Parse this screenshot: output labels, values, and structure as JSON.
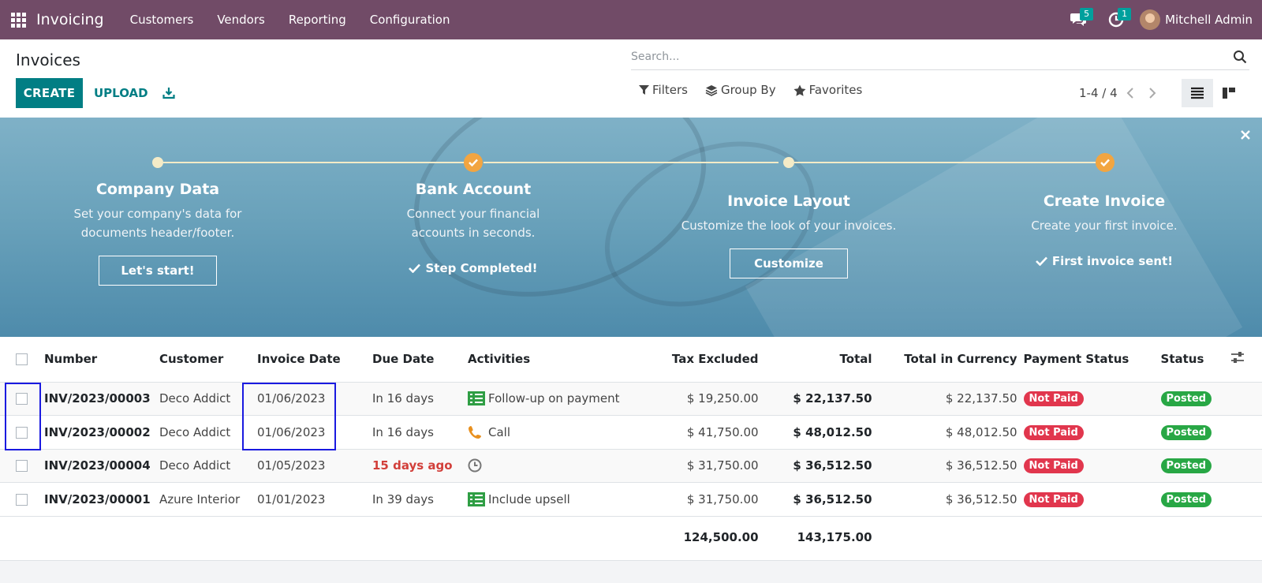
{
  "navbar": {
    "app_name": "Invoicing",
    "menu": [
      "Customers",
      "Vendors",
      "Reporting",
      "Configuration"
    ],
    "messages_count": "5",
    "activities_count": "1",
    "user_name": "Mitchell Admin",
    "brand_color": "#714b67"
  },
  "control_panel": {
    "title": "Invoices",
    "create_label": "CREATE",
    "upload_label": "UPLOAD",
    "search_placeholder": "Search...",
    "filters_label": "Filters",
    "group_by_label": "Group By",
    "favorites_label": "Favorites",
    "pager_value": "1-4 / 4"
  },
  "onboarding": {
    "steps": [
      {
        "title": "Company Data",
        "desc": "Set your company's data for documents header/footer.",
        "button": "Let's start!",
        "done": ""
      },
      {
        "title": "Bank Account",
        "desc": "Connect your financial accounts in seconds.",
        "button": "",
        "done": "Step Completed!"
      },
      {
        "title": "Invoice Layout",
        "desc": "Customize the look of your invoices.",
        "button": "Customize",
        "done": ""
      },
      {
        "title": "Create Invoice",
        "desc": "Create your first invoice.",
        "button": "",
        "done": "First invoice sent!"
      }
    ]
  },
  "table": {
    "columns": [
      "Number",
      "Customer",
      "Invoice Date",
      "Due Date",
      "Activities",
      "Tax Excluded",
      "Total",
      "Total in Currency",
      "Payment Status",
      "Status"
    ],
    "rows": [
      {
        "number": "INV/2023/00003",
        "customer": "Deco Addict",
        "invoice_date": "01/06/2023",
        "due_date": "In 16 days",
        "activity": "Follow-up on payment",
        "activity_icon": "todo-icon",
        "tax_excluded": "$ 19,250.00",
        "total": "$ 22,137.50",
        "total_currency": "$ 22,137.50",
        "payment_status": "Not Paid",
        "status": "Posted"
      },
      {
        "number": "INV/2023/00002",
        "customer": "Deco Addict",
        "invoice_date": "01/06/2023",
        "due_date": "In 16 days",
        "activity": "Call",
        "activity_icon": "phone-icon",
        "tax_excluded": "$ 41,750.00",
        "total": "$ 48,012.50",
        "total_currency": "$ 48,012.50",
        "payment_status": "Not Paid",
        "status": "Posted"
      },
      {
        "number": "INV/2023/00004",
        "customer": "Deco Addict",
        "invoice_date": "01/05/2023",
        "due_date": "15 days ago",
        "activity": "",
        "activity_icon": "clock-icon",
        "tax_excluded": "$ 31,750.00",
        "total": "$ 36,512.50",
        "total_currency": "$ 36,512.50",
        "payment_status": "Not Paid",
        "status": "Posted"
      },
      {
        "number": "INV/2023/00001",
        "customer": "Azure Interior",
        "invoice_date": "01/01/2023",
        "due_date": "In 39 days",
        "activity": "Include upsell",
        "activity_icon": "todo-icon",
        "tax_excluded": "$ 31,750.00",
        "total": "$ 36,512.50",
        "total_currency": "$ 36,512.50",
        "payment_status": "Not Paid",
        "status": "Posted"
      }
    ],
    "totals": {
      "tax_excluded": "124,500.00",
      "total": "143,175.00"
    }
  }
}
